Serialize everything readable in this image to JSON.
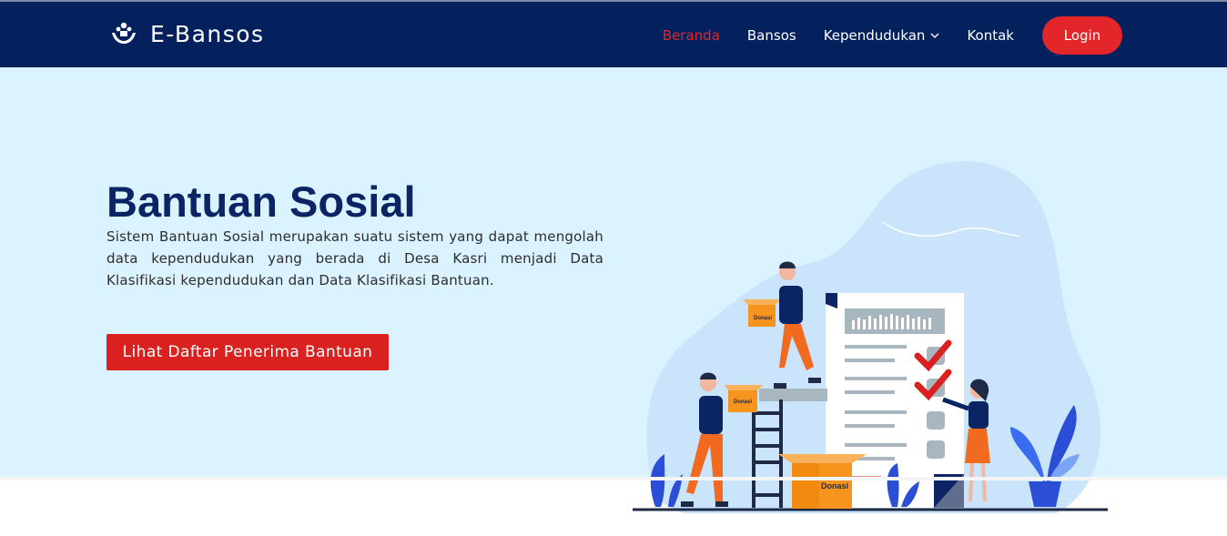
{
  "brand": {
    "name": "E-Bansos",
    "icon": "hands-people-icon"
  },
  "nav": {
    "items": [
      {
        "label": "Beranda",
        "active": true
      },
      {
        "label": "Bansos"
      },
      {
        "label": "Kependudukan",
        "has_dropdown": true
      },
      {
        "label": "Kontak"
      }
    ],
    "login_label": "Login"
  },
  "hero": {
    "title": "Bantuan Sosial",
    "description": "Sistem Bantuan Sosial merupakan suatu sistem yang dapat mengolah data kependudukan yang berada di Desa Kasri menjadi Data Klasifikasi kependudukan dan Data Klasifikasi Bantuan.",
    "cta_label": "Lihat Daftar Penerima Bantuan",
    "illustration_box_labels": [
      "Donasi",
      "Donasi",
      "Donasi"
    ]
  },
  "colors": {
    "navbar": "#04215e",
    "accent_red": "#e3262a",
    "hero_bg": "#dbf3ff",
    "title": "#0b2464"
  }
}
